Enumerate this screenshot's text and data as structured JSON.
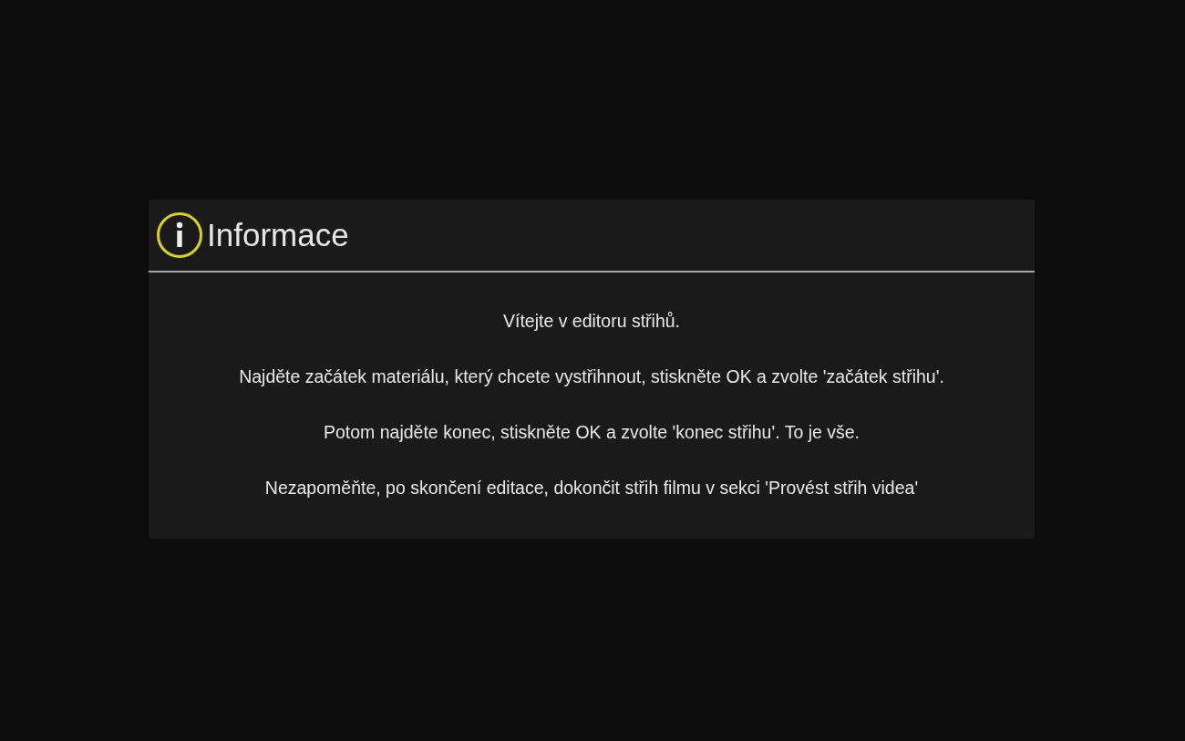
{
  "dialog": {
    "title": "Informace",
    "paragraphs": [
      "Vítejte v editoru střihů.",
      "Najděte začátek materiálu, který chcete vystřihnout, stiskněte OK a zvolte 'začátek střihu'.",
      "Potom najděte konec, stiskněte OK a zvolte 'konec střihu'. To je vše.",
      "Nezapoměňte, po skončení editace, dokončit střih filmu v sekci 'Provést střih videa'"
    ]
  }
}
